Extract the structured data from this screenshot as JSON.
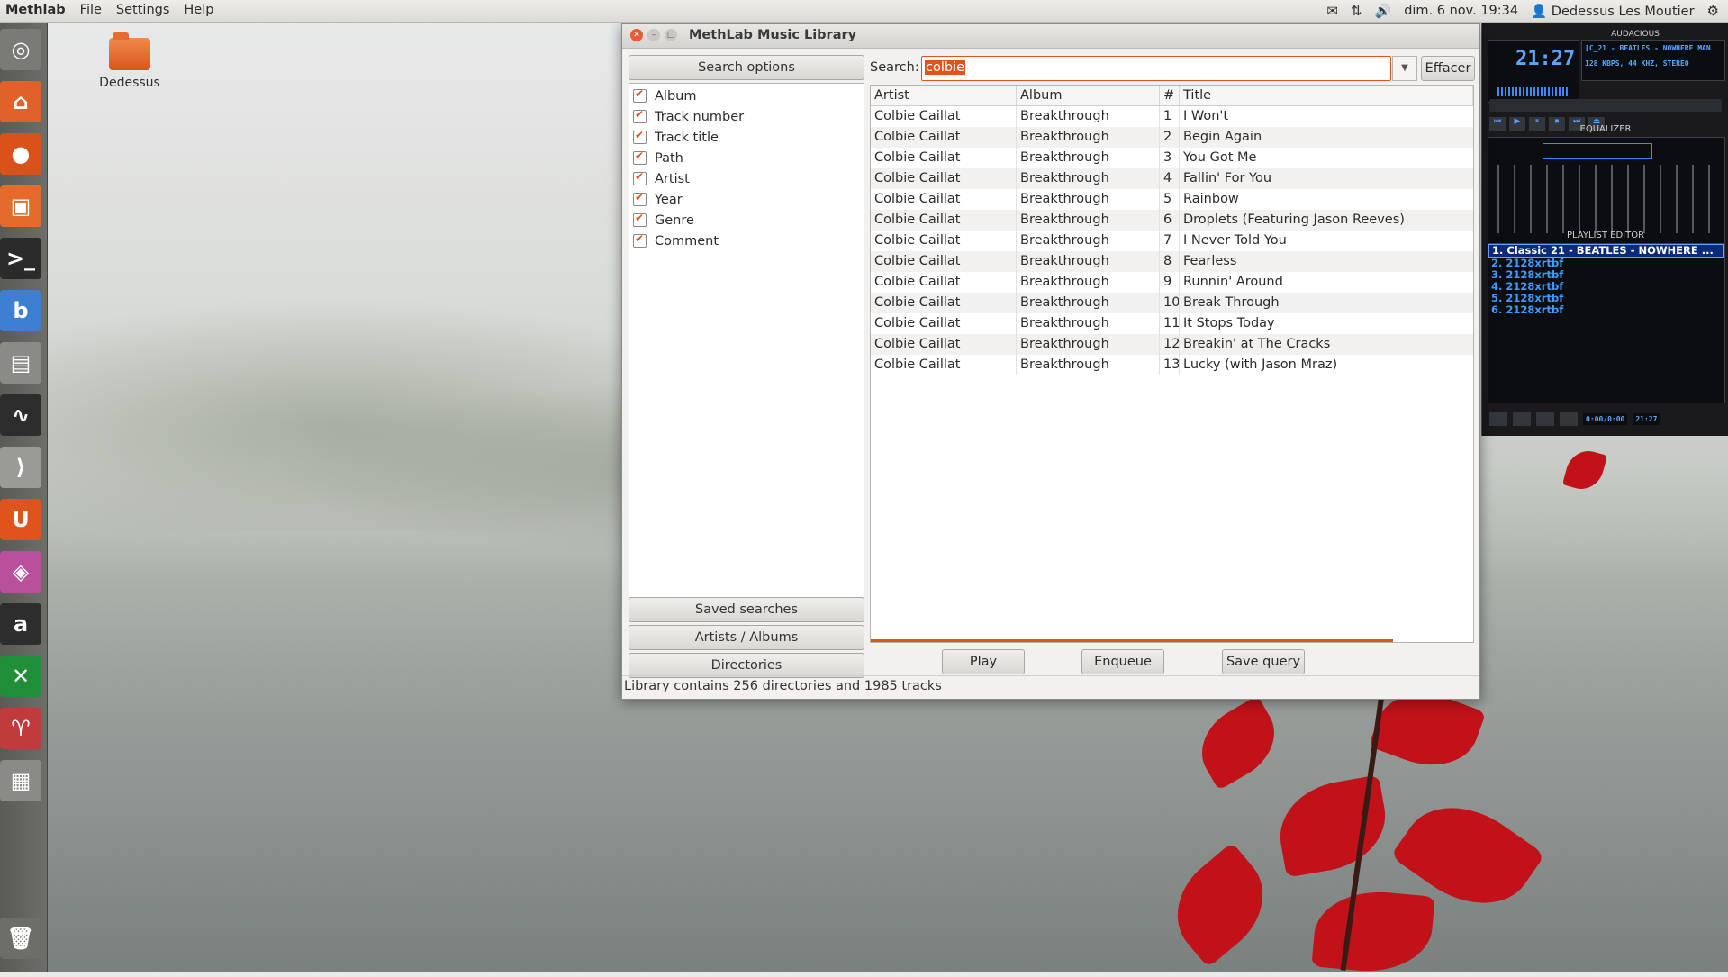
{
  "top_panel": {
    "app_name": "Methlab",
    "menu": [
      "File",
      "Settings",
      "Help"
    ],
    "datetime": "dim. 6 nov. 19:34",
    "user": "Dedessus Les Moutier"
  },
  "desktop": {
    "icon_label": "Dedessus"
  },
  "window": {
    "title": "MethLab Music Library",
    "search_options_label": "Search options",
    "options": [
      "Album",
      "Track number",
      "Track title",
      "Path",
      "Artist",
      "Year",
      "Genre",
      "Comment"
    ],
    "saved_searches_label": "Saved searches",
    "artists_albums_label": "Artists / Albums",
    "directories_label": "Directories",
    "search_label": "Search:",
    "search_value": "colbie",
    "clear_label": "Effacer",
    "columns": [
      "Artist",
      "Album",
      "#",
      "Title"
    ],
    "tracks": [
      [
        "Colbie Caillat",
        "Breakthrough",
        "1",
        "I Won't"
      ],
      [
        "Colbie Caillat",
        "Breakthrough",
        "2",
        "Begin Again"
      ],
      [
        "Colbie Caillat",
        "Breakthrough",
        "3",
        "You Got Me"
      ],
      [
        "Colbie Caillat",
        "Breakthrough",
        "4",
        "Fallin' For You"
      ],
      [
        "Colbie Caillat",
        "Breakthrough",
        "5",
        "Rainbow"
      ],
      [
        "Colbie Caillat",
        "Breakthrough",
        "6",
        "Droplets (Featuring Jason Reeves)"
      ],
      [
        "Colbie Caillat",
        "Breakthrough",
        "7",
        "I Never Told You"
      ],
      [
        "Colbie Caillat",
        "Breakthrough",
        "8",
        "Fearless"
      ],
      [
        "Colbie Caillat",
        "Breakthrough",
        "9",
        "Runnin' Around"
      ],
      [
        "Colbie Caillat",
        "Breakthrough",
        "10",
        "Break Through"
      ],
      [
        "Colbie Caillat",
        "Breakthrough",
        "11",
        "It Stops Today"
      ],
      [
        "Colbie Caillat",
        "Breakthrough",
        "12",
        "Breakin' at The Cracks"
      ],
      [
        "Colbie Caillat",
        "Breakthrough",
        "13",
        "Lucky (with Jason Mraz)"
      ]
    ],
    "play_label": "Play",
    "enqueue_label": "Enqueue",
    "save_query_label": "Save query",
    "status": "Library contains 256 directories and 1985 tracks",
    "accent_color": "#e0531d"
  },
  "audacious": {
    "title": "AUDACIOUS",
    "time": "21:27",
    "song_ticker": "[C_21 - BEATLES - NOWHERE MAN",
    "stream_info": "128 KBPS, 44 KHZ, STEREO",
    "equalizer_label": "EQUALIZER",
    "playlist_editor_label": "PLAYLIST EDITOR",
    "playlist": [
      "1. Classic 21 - BEATLES - NOWHERE ...",
      "2. 2128xrtbf",
      "3. 2128xrtbf",
      "4. 2128xrtbf",
      "5. 2128xrtbf",
      "6. 2128xrtbf"
    ],
    "playlist_time": "0:00/0:00",
    "playlist_remaining": "21:27"
  }
}
